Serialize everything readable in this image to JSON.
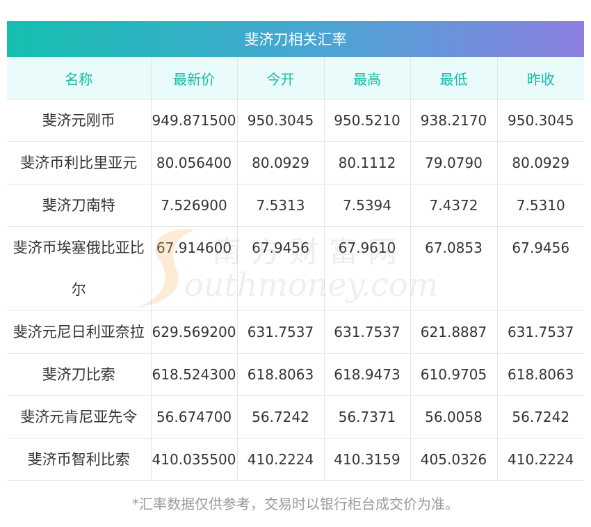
{
  "table": {
    "title": "斐济刀相关汇率",
    "headers": [
      "名称",
      "最新价",
      "今开",
      "最高",
      "最低",
      "昨收"
    ],
    "rows": [
      [
        "斐济元刚币",
        "949.871500",
        "950.3045",
        "950.5210",
        "938.2170",
        "950.3045"
      ],
      [
        "斐济币利比里亚元",
        "80.056400",
        "80.0929",
        "80.1112",
        "79.0790",
        "80.0929"
      ],
      [
        "斐济刀南特",
        "7.526900",
        "7.5313",
        "7.5394",
        "7.4372",
        "7.5310"
      ],
      [
        "斐济币埃塞俄比亚比尔",
        "67.914600",
        "67.9456",
        "67.9610",
        "67.0853",
        "67.9456"
      ],
      [
        "斐济元尼日利亚奈拉",
        "629.569200",
        "631.7537",
        "631.7537",
        "621.8887",
        "631.7537"
      ],
      [
        "斐济刀比索",
        "618.524300",
        "618.8063",
        "618.9473",
        "610.9705",
        "618.8063"
      ],
      [
        "斐济元肯尼亚先令",
        "56.674700",
        "56.7242",
        "56.7371",
        "56.0058",
        "56.7242"
      ],
      [
        "斐济币智利比索",
        "410.035500",
        "410.2224",
        "410.3159",
        "405.0326",
        "410.2224"
      ]
    ]
  },
  "footnote": "*汇率数据仅供参考，交易时以银行柜台成交价为准。",
  "watermark": {
    "cn": "南方财富网",
    "en": "outhmoney.com"
  },
  "colors": {
    "header_text": "#18b9aa",
    "header_bg": "#e9fbfa",
    "title_gradient_start": "#15bfb0",
    "title_gradient_end": "#8c7fe0"
  }
}
